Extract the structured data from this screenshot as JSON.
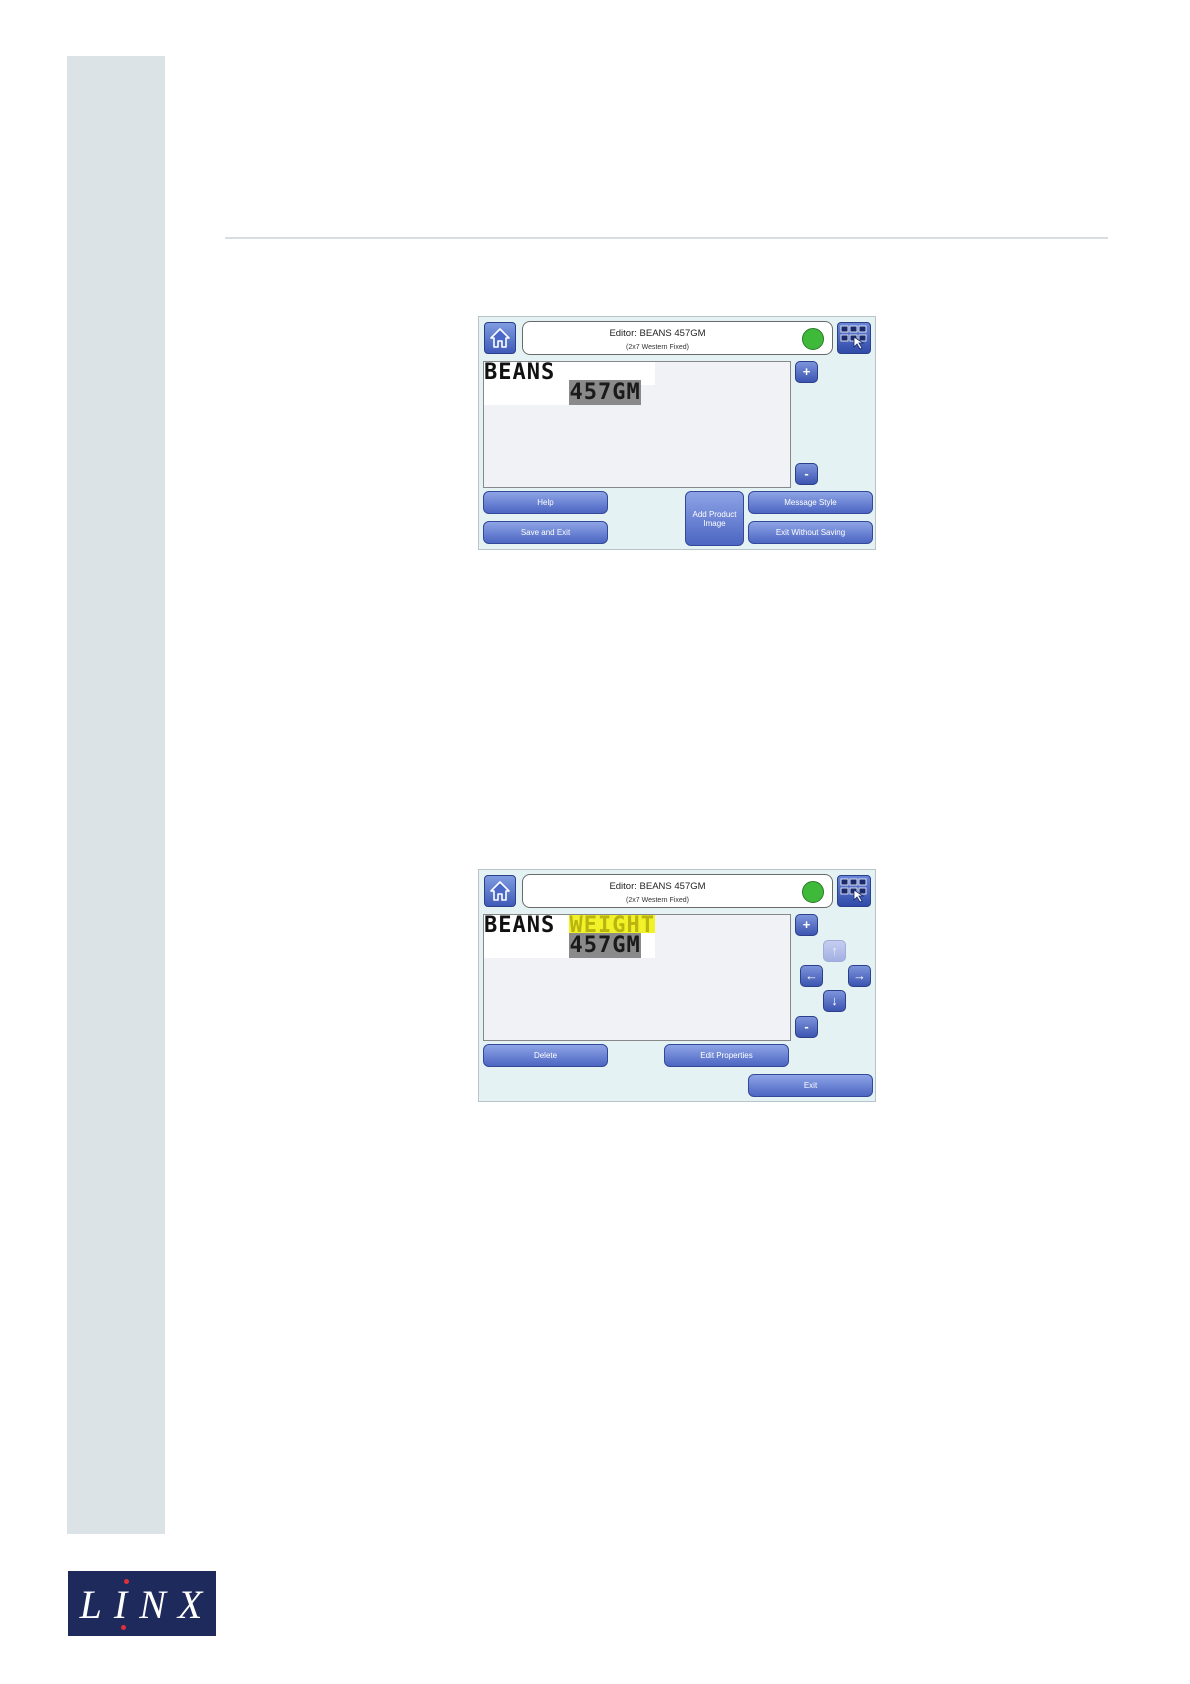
{
  "brand": {
    "logo_text": "LINX",
    "accent_color": "#1e2a5c",
    "dot_color": "#e0303a"
  },
  "screen1": {
    "title": "Editor: BEANS 457GM",
    "subtitle": "(2x7 Western Fixed)",
    "status_color": "#3fb93a",
    "line1_text": "BEANS",
    "line2_text": "457GM",
    "zoom_in": "+",
    "zoom_out": "-",
    "buttons": {
      "help": "Help",
      "save_exit": "Save and Exit",
      "add_product_image": "Add Product Image",
      "message_style": "Message Style",
      "exit_without_saving": "Exit Without Saving"
    }
  },
  "screen2": {
    "title": "Editor: BEANS 457GM",
    "subtitle": "(2x7 Western Fixed)",
    "status_color": "#3fb93a",
    "line1_text": "BEANS ",
    "line1_selected": "WEIGHT",
    "line2_text": "457GM",
    "zoom_in": "+",
    "zoom_out": "-",
    "arrows": {
      "up": "↑",
      "left": "←",
      "right": "→",
      "down": "↓"
    },
    "buttons": {
      "delete": "Delete",
      "edit_properties": "Edit Properties",
      "exit": "Exit"
    }
  }
}
